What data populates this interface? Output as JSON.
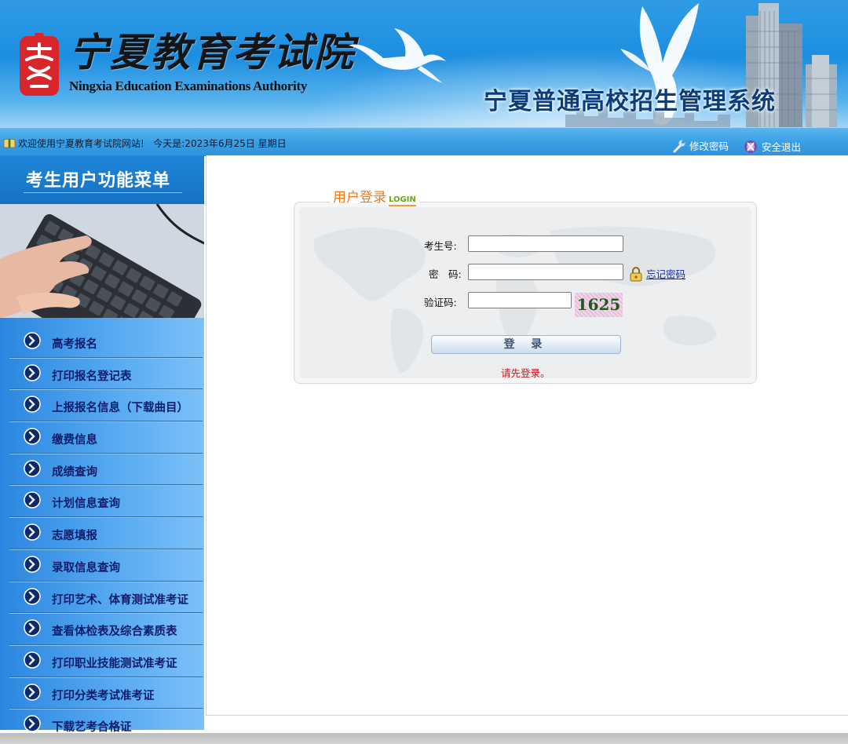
{
  "header": {
    "org_name_cn": "宁夏教育考试院",
    "org_name_en": "Ningxia Education Examinations Authority",
    "system_title": "宁夏普通高校招生管理系统"
  },
  "statusbar": {
    "welcome": "欢迎使用宁夏教育考试院网站!",
    "date_text": "今天是:2023年6月25日 星期日",
    "change_password": "修改密码",
    "logout": "安全退出"
  },
  "sidebar": {
    "title": "考生用户功能菜单",
    "items": [
      {
        "label": "高考报名"
      },
      {
        "label": "打印报名登记表"
      },
      {
        "label": "上报报名信息（下载曲目）"
      },
      {
        "label": "缴费信息"
      },
      {
        "label": "成绩查询"
      },
      {
        "label": "计划信息查询"
      },
      {
        "label": "志愿填报"
      },
      {
        "label": "录取信息查询"
      },
      {
        "label": "打印艺术、体育测试准考证"
      },
      {
        "label": "查看体检表及综合素质表"
      },
      {
        "label": "打印职业技能测试准考证"
      },
      {
        "label": "打印分类考试准考证"
      },
      {
        "label": "下载艺考合格证"
      }
    ]
  },
  "login": {
    "legend_cn": "用户登录",
    "legend_en": "LOGIN",
    "exam_no_label": "考生号:",
    "exam_no_value": "",
    "password_label": "密　码:",
    "password_value": "",
    "captcha_label": "验证码:",
    "captcha_value": "",
    "captcha_code": "1625",
    "forgot_password": "忘记密码",
    "submit_label": "登 录",
    "message": "请先登录。"
  },
  "colors": {
    "header_blue": "#1d8ee0",
    "menu_text": "#0e1d6b",
    "legend_orange": "#ee7a1a",
    "error_red": "#c4161c"
  },
  "icons": [
    "seal-logo-icon",
    "dove-icon",
    "book-icon",
    "wrench-icon",
    "logout-icon",
    "circle-arrow-icon",
    "lock-icon"
  ]
}
